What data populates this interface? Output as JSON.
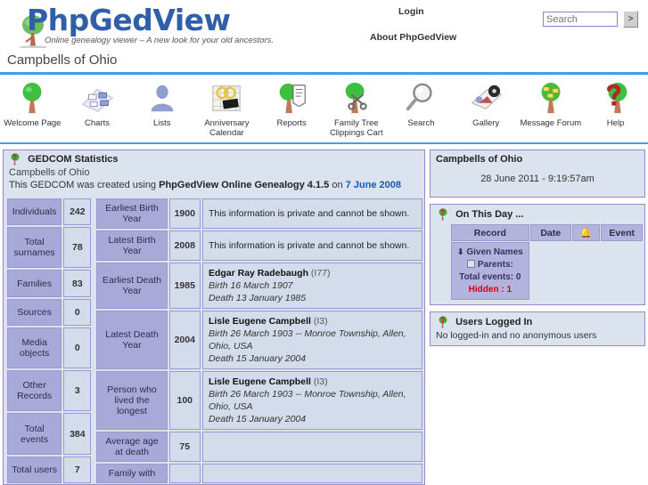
{
  "header": {
    "logo_main": "PhpGedView",
    "logo_tagline_plain": "Online genealogy viewer – ",
    "logo_tagline_italic": "A new look for your old ancestors.",
    "login_label": "Login",
    "about_label": "About PhpGedView",
    "search_placeholder": "Search",
    "search_value": "",
    "search_go_label": ">"
  },
  "page_title": "Campbells of Ohio",
  "nav": [
    {
      "label": "Welcome Page",
      "icon": "tree-icon"
    },
    {
      "label": "Charts",
      "icon": "chart-icon"
    },
    {
      "label": "Lists",
      "icon": "person-icon"
    },
    {
      "label": "Anniversary Calendar",
      "icon": "calendar-icon"
    },
    {
      "label": "Reports",
      "icon": "report-icon"
    },
    {
      "label": "Family Tree Clippings Cart",
      "icon": "scissors-tree-icon"
    },
    {
      "label": "Search",
      "icon": "magnifier-icon"
    },
    {
      "label": "Gallery",
      "icon": "gallery-icon"
    },
    {
      "label": "Message Forum",
      "icon": "message-tree-icon"
    },
    {
      "label": "Help",
      "icon": "question-tree-icon"
    }
  ],
  "stats": {
    "panel_title": "GEDCOM Statistics",
    "gedcom_name": "Campbells of Ohio",
    "created_prefix": "This GEDCOM was created using ",
    "created_app": "PhpGedView Online Genealogy 4.1.5",
    "created_on": " on ",
    "created_date": "7 June 2008",
    "left_rows": [
      {
        "label": "Individuals",
        "value": "242"
      },
      {
        "label": "Total surnames",
        "value": "78"
      },
      {
        "label": "Families",
        "value": "83"
      },
      {
        "label": "Sources",
        "value": "0"
      },
      {
        "label": "Media objects",
        "value": "0"
      },
      {
        "label": "Other Records",
        "value": "3"
      },
      {
        "label": "Total events",
        "value": "384"
      },
      {
        "label": "Total users",
        "value": "7"
      }
    ],
    "right_rows": [
      {
        "label": "Earliest Birth Year",
        "value": "1900",
        "detail_private": "This information is private and cannot be shown."
      },
      {
        "label": "Latest Birth Year",
        "value": "2008",
        "detail_private": "This information is private and cannot be shown."
      },
      {
        "label": "Earliest Death Year",
        "value": "1985",
        "person_name": "Edgar Ray Radebaugh",
        "person_id": "(I77)",
        "birth": "Birth 16 March 1907",
        "death": "Death 13 January 1985"
      },
      {
        "label": "Latest Death Year",
        "value": "2004",
        "person_name": "Lisle Eugene Campbell",
        "person_id": "(I3)",
        "birth": "Birth 26 March 1903 -- Monroe Township, Allen, Ohio, USA",
        "death": "Death 15 January 2004"
      },
      {
        "label": "Person who lived the longest",
        "value": "100",
        "person_name": "Lisle Eugene Campbell",
        "person_id": "(I3)",
        "birth": "Birth 26 March 1903 -- Monroe Township, Allen, Ohio, USA",
        "death": "Death 15 January 2004"
      },
      {
        "label": "Average age at death",
        "value": "75"
      },
      {
        "label": "Family with",
        "value": ""
      }
    ]
  },
  "sidebar": {
    "tree_panel": {
      "title": "Campbells of Ohio",
      "timestamp": "28 June 2011 - 9:19:57am"
    },
    "on_this_day": {
      "title": "On This Day ...",
      "columns": [
        "Record",
        "Date",
        "bell-icon",
        "Event"
      ],
      "given_names": "Given Names",
      "parents_label": "Parents:",
      "total_events": "Total events: 0",
      "hidden": "Hidden : 1"
    },
    "users_logged_in": {
      "title": "Users Logged In",
      "body": "No logged-in and no anonymous users"
    }
  },
  "colors": {
    "accent_blue": "#3fa0e8",
    "label_purple": "#a9a9d9",
    "panel_bg": "#dbe3ef",
    "link_blue": "#1a57b5",
    "hidden_red": "#dd0000"
  }
}
